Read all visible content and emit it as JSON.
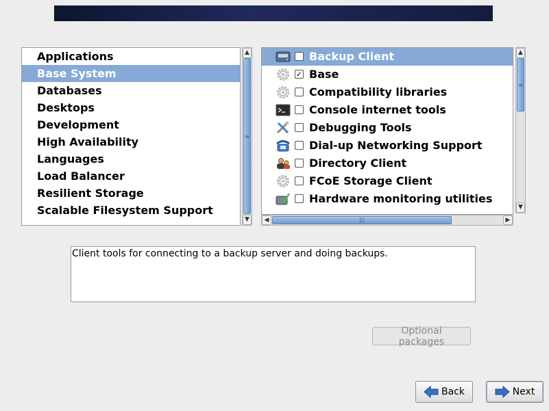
{
  "groups": [
    {
      "label": "Applications",
      "selected": false
    },
    {
      "label": "Base System",
      "selected": true
    },
    {
      "label": "Databases",
      "selected": false
    },
    {
      "label": "Desktops",
      "selected": false
    },
    {
      "label": "Development",
      "selected": false
    },
    {
      "label": "High Availability",
      "selected": false
    },
    {
      "label": "Languages",
      "selected": false
    },
    {
      "label": "Load Balancer",
      "selected": false
    },
    {
      "label": "Resilient Storage",
      "selected": false
    },
    {
      "label": "Scalable Filesystem Support",
      "selected": false
    }
  ],
  "packages": [
    {
      "label": "Backup Client",
      "checked": false,
      "selected": true,
      "icon": "backup-drive-icon"
    },
    {
      "label": "Base",
      "checked": true,
      "selected": false,
      "icon": "gear-icon"
    },
    {
      "label": "Compatibility libraries",
      "checked": false,
      "selected": false,
      "icon": "gear-icon"
    },
    {
      "label": "Console internet tools",
      "checked": false,
      "selected": false,
      "icon": "terminal-icon"
    },
    {
      "label": "Debugging Tools",
      "checked": false,
      "selected": false,
      "icon": "tools-icon"
    },
    {
      "label": "Dial-up Networking Support",
      "checked": false,
      "selected": false,
      "icon": "telephone-icon"
    },
    {
      "label": "Directory Client",
      "checked": false,
      "selected": false,
      "icon": "directory-users-icon"
    },
    {
      "label": "FCoE Storage Client",
      "checked": false,
      "selected": false,
      "icon": "gear-icon"
    },
    {
      "label": "Hardware monitoring utilities",
      "checked": false,
      "selected": false,
      "icon": "hardware-monitor-icon"
    }
  ],
  "description": "Client tools for connecting to a backup server and doing backups.",
  "buttons": {
    "optional": "Optional packages",
    "back": "Back",
    "next": "Next"
  },
  "scroll_glyphs": {
    "up": "▲",
    "down": "▼",
    "left": "◀",
    "right": "▶",
    "grip_v": "≡",
    "grip_h": "|||"
  },
  "check_glyph": "✓",
  "colors": {
    "selection": "#86a9d6",
    "banner": "#1f2a5c"
  }
}
